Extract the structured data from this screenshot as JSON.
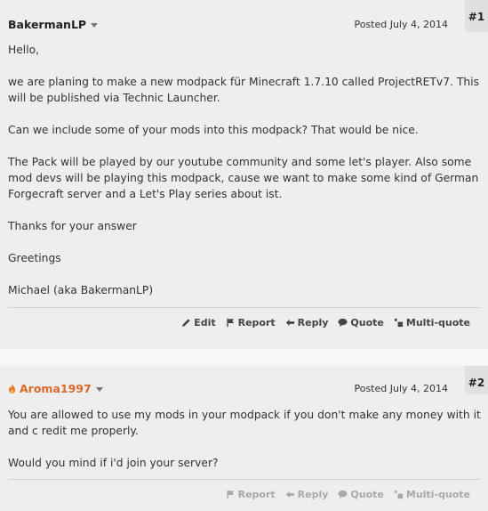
{
  "posts": [
    {
      "number": "#1",
      "author": "BakermanLP",
      "posted": "Posted July 4, 2014",
      "paragraphs": [
        "Hello,",
        "we are planing to make a new modpack für Minecraft 1.7.10 called ProjectRETv7. This will be published via Technic Launcher.",
        "Can we include some of your mods into this modpack? That would be nice.",
        "The Pack will be played by our youtube community and some let's player. Also some mod devs will be playing this modpack, cause we want to make some kind of German Forgecraft server and a Let's Play series about ist.",
        "Thanks for your answer",
        "Greetings",
        "Michael (aka BakermanLP)"
      ],
      "actions": {
        "edit": "Edit",
        "report": "Report",
        "reply": "Reply",
        "quote": "Quote",
        "multiquote": "Multi-quote"
      }
    },
    {
      "number": "#2",
      "author": "Aroma1997",
      "posted": "Posted July 4, 2014",
      "paragraphs": [
        "You are allowed to use my mods in your modpack if you don't make any money with it and c redit me properly.",
        "Would you mind if i'd join your server?"
      ],
      "actions": {
        "report": "Report",
        "reply": "Reply",
        "quote": "Quote",
        "multiquote": "Multi-quote"
      }
    }
  ],
  "colors": {
    "author_staff": "#d9682a",
    "author_default": "#222222",
    "action_active": "#444444",
    "action_faded": "#a8a8a8"
  }
}
